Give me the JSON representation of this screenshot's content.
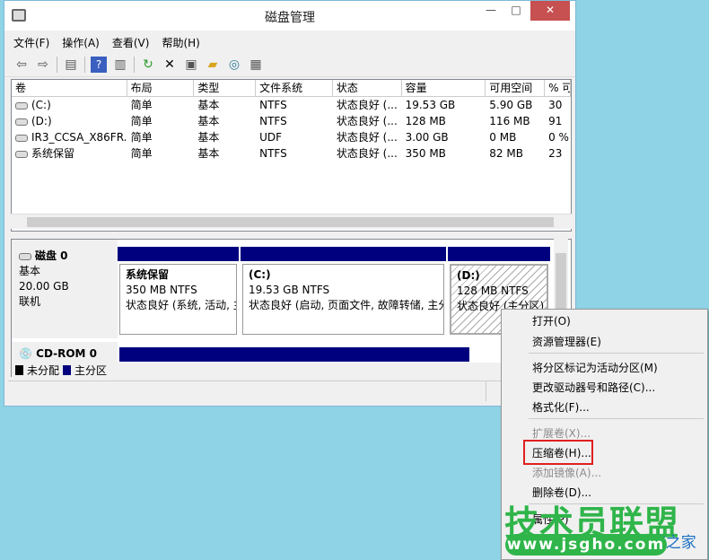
{
  "window": {
    "title": "磁盘管理",
    "minimize": "—",
    "maximize": "□",
    "close": "✕"
  },
  "menubar": [
    "文件(F)",
    "操作(A)",
    "查看(V)",
    "帮助(H)"
  ],
  "toolbar": [
    "back-icon",
    "forward-icon",
    "console-tree-icon",
    "help-icon",
    "action-pane-icon",
    "refresh-icon",
    "delete-icon",
    "properties-icon",
    "open-icon",
    "explore-icon",
    "settings-icon"
  ],
  "volume_list": {
    "headers": [
      "卷",
      "布局",
      "类型",
      "文件系统",
      "状态",
      "容量",
      "可用空间",
      "% 可"
    ],
    "rows": [
      [
        "(C:)",
        "简单",
        "基本",
        "NTFS",
        "状态良好 (...",
        "19.53 GB",
        "5.90 GB",
        "30"
      ],
      [
        "(D:)",
        "简单",
        "基本",
        "NTFS",
        "状态良好 (...",
        "128 MB",
        "116 MB",
        "91"
      ],
      [
        "IR3_CCSA_X86FR...",
        "简单",
        "基本",
        "UDF",
        "状态良好 (...",
        "3.00 GB",
        "0 MB",
        "0 %"
      ],
      [
        "系统保留",
        "简单",
        "基本",
        "NTFS",
        "状态良好 (...",
        "350 MB",
        "82 MB",
        "23"
      ]
    ]
  },
  "disk0": {
    "name": "磁盘 0",
    "type": "基本",
    "size": "20.00 GB",
    "status": "联机",
    "partitions": [
      {
        "name": "系统保留",
        "size": "350 MB NTFS",
        "status": "状态良好 (系统, 活动, 主"
      },
      {
        "name": "(C:)",
        "size": "19.53 GB NTFS",
        "status": "状态良好 (启动, 页面文件, 故障转储, 主分"
      },
      {
        "name": "(D:)",
        "size": "128 MB NTFS",
        "status": "状态良好 (主分区)"
      }
    ]
  },
  "cdrom": {
    "name": "CD-ROM 0"
  },
  "legend": [
    {
      "label": "未分配",
      "color": "#000000"
    },
    {
      "label": "主分区",
      "color": "#00007f"
    }
  ],
  "context_menu": {
    "items": [
      {
        "label": "打开(O)",
        "enabled": true
      },
      {
        "label": "资源管理器(E)",
        "enabled": true
      },
      {
        "label": "将分区标记为活动分区(M)",
        "enabled": true
      },
      {
        "label": "更改驱动器号和路径(C)...",
        "enabled": true
      },
      {
        "label": "格式化(F)...",
        "enabled": true
      },
      {
        "label": "扩展卷(X)...",
        "enabled": false
      },
      {
        "label": "压缩卷(H)...",
        "enabled": true,
        "highlighted": true
      },
      {
        "label": "添加镜像(A)...",
        "enabled": false
      },
      {
        "label": "删除卷(D)...",
        "enabled": true
      },
      {
        "label": "属性(P)",
        "enabled": true
      }
    ]
  },
  "watermark": {
    "brand": "技术员联盟",
    "url": "www.jsgho.com",
    "secondary": "Win8系统之家"
  }
}
